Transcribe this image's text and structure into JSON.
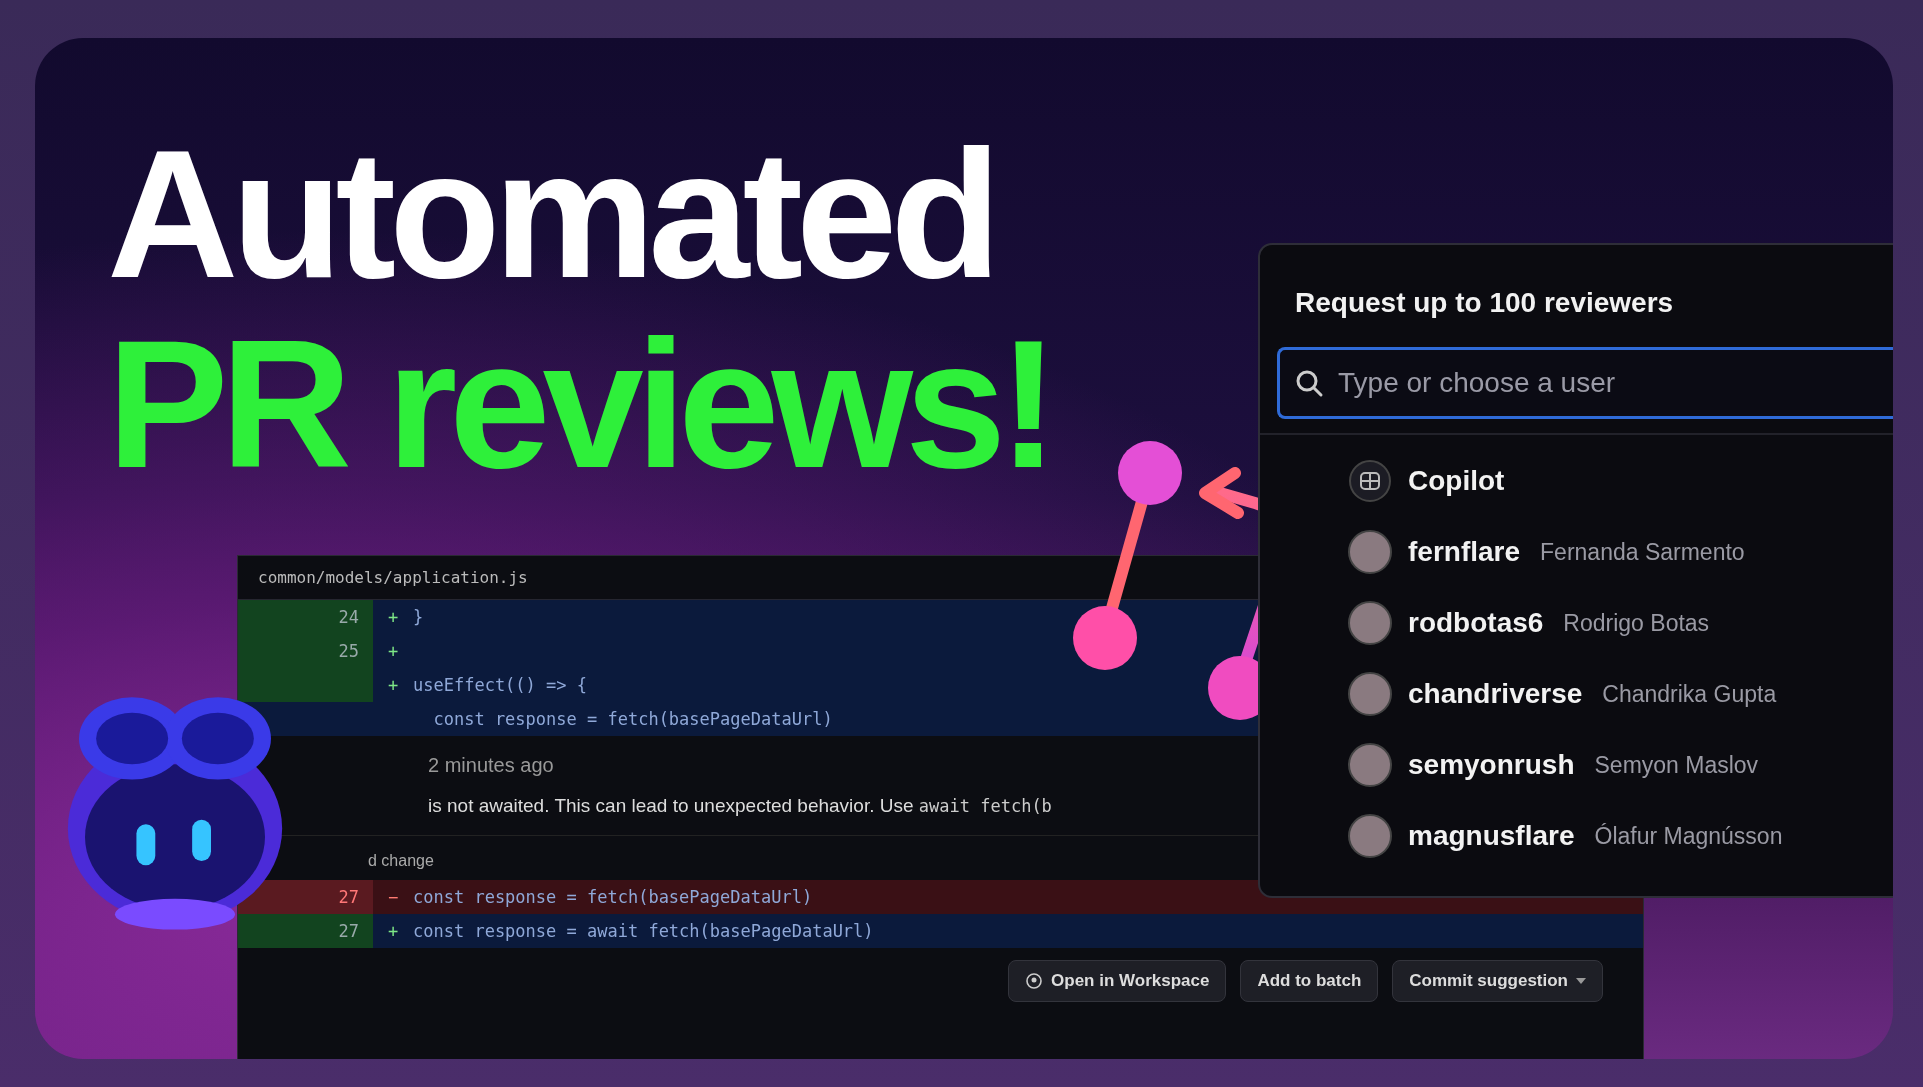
{
  "headline": {
    "line_1": "Automated",
    "line_2": "PR reviews!"
  },
  "code_review": {
    "file_path": "common/models/application.js",
    "lines": [
      {
        "kind": "added",
        "number": "24",
        "sign": "+",
        "code": "}"
      },
      {
        "kind": "added",
        "number": "25",
        "sign": "+"
      },
      {
        "kind": "added",
        "sign": "+",
        "code": "useEffect(() => {"
      },
      {
        "kind": "context",
        "code": "  const response = fetch(basePageDataUrl)"
      }
    ],
    "comment": {
      "time": "2 minutes ago",
      "text": "is not awaited. This can lead to unexpected behavior. Use",
      "code": "await fetch(b"
    },
    "suggestion_label": "d change",
    "suggestion": [
      {
        "kind": "removed",
        "number": "27",
        "sign": "−",
        "code": "const response = fetch(basePageDataUrl)"
      },
      {
        "kind": "added",
        "number": "27",
        "sign": "+",
        "code": "const response = await fetch(basePageDataUrl)"
      }
    ],
    "buttons": [
      {
        "label": "Open in Workspace",
        "kind": "icon"
      },
      {
        "label": "Add to batch",
        "kind": "plain"
      },
      {
        "label": "Commit suggestion",
        "kind": "dropdown"
      }
    ]
  },
  "reviewers": {
    "title": "Request up to 100 reviewers",
    "search": {
      "placeholder": "Type or choose a user"
    },
    "users": [
      {
        "kind": "bot",
        "username": "Copilot"
      },
      {
        "kind": "person",
        "username": "fernflare",
        "name": "Fernanda Sarmento"
      },
      {
        "kind": "person",
        "username": "rodbotas6",
        "name": "Rodrigo Botas"
      },
      {
        "kind": "person",
        "username": "chandriverse",
        "name": "Chandrika Gupta"
      },
      {
        "kind": "person",
        "username": "semyonrush",
        "name": "Semyon Maslov"
      },
      {
        "kind": "person",
        "username": "magnusflare",
        "name": "Ólafur Magnússon"
      }
    ]
  }
}
